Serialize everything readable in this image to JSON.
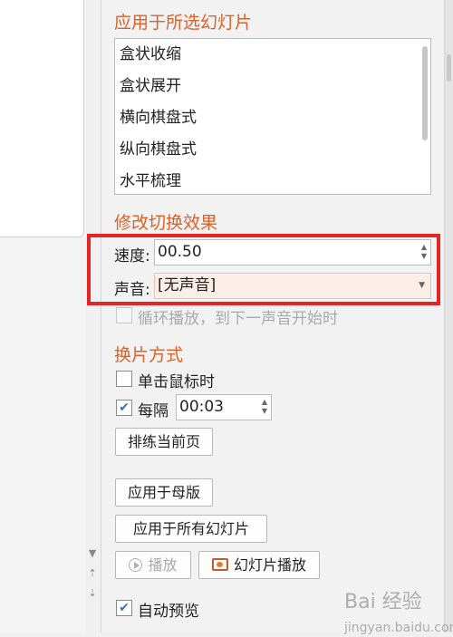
{
  "apply_section": {
    "title": "应用于所选幻灯片",
    "transitions": [
      "盒状收缩",
      "盒状展开",
      "横向棋盘式",
      "纵向棋盘式",
      "水平梳理"
    ]
  },
  "modify_section": {
    "title": "修改切换效果",
    "speed_label": "速度:",
    "speed_value": "00.50",
    "sound_label": "声音:",
    "sound_value": "[无声音]",
    "loop_label": "循环播放，到下一声音开始时"
  },
  "advance_section": {
    "title": "换片方式",
    "on_click_label": "单击鼠标时",
    "on_click_checked": false,
    "every_label": "每隔",
    "every_checked": true,
    "every_value": "00:03"
  },
  "buttons": {
    "rehearse": "排练当前页",
    "apply_master": "应用于母版",
    "apply_all": "应用于所有幻灯片",
    "play": "播放",
    "slideshow": "幻灯片播放"
  },
  "auto_preview": {
    "label": "自动预览",
    "checked": true
  },
  "watermark": {
    "text": "Bai 经验",
    "sub": "jingyan.baidu.com"
  },
  "colors": {
    "section_title": "#d9622b",
    "highlight_box": "#e32525",
    "checkbox_check": "#3b6fc2"
  }
}
